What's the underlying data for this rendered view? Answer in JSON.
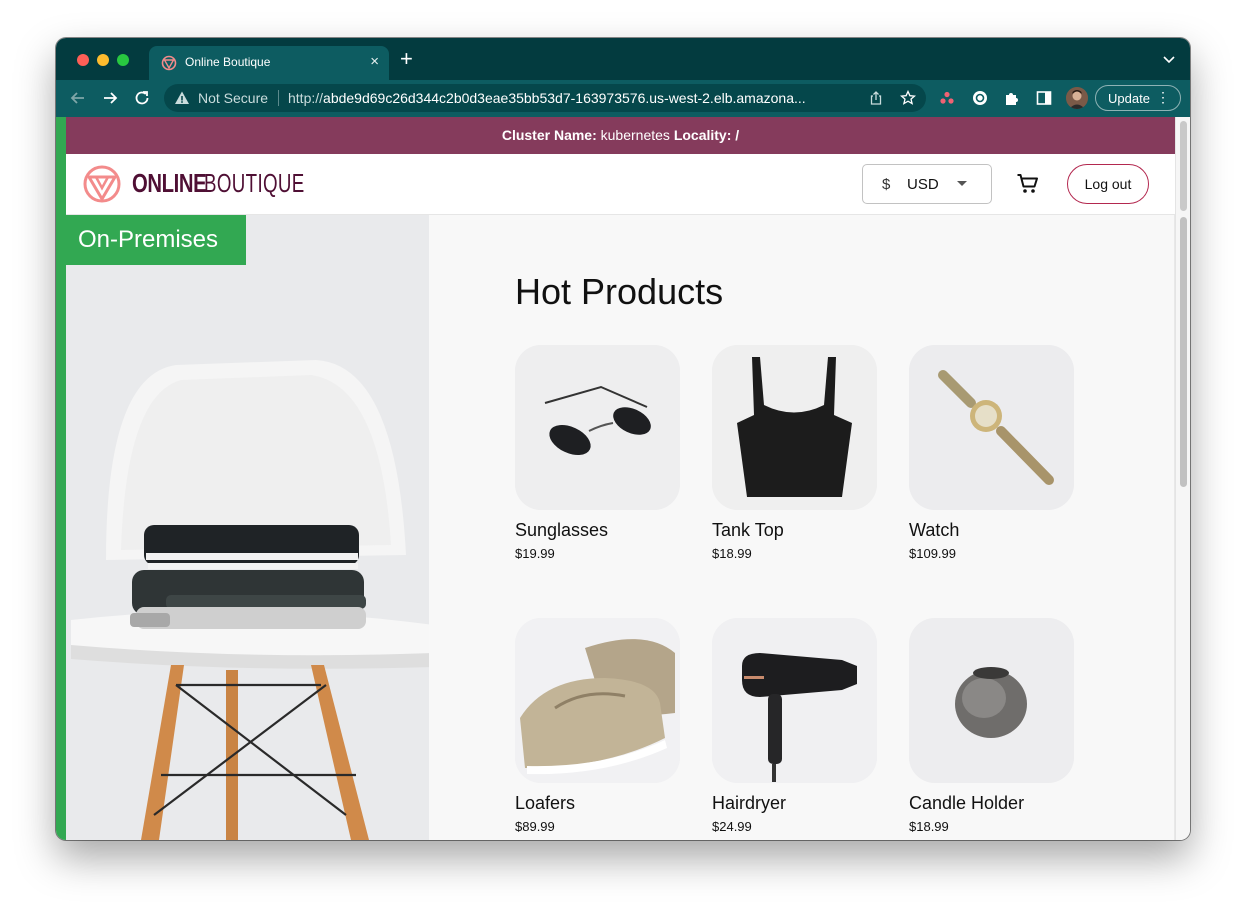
{
  "browser": {
    "tab_title": "Online Boutique",
    "tab_close": "×",
    "new_tab": "+",
    "security_label": "Not Secure",
    "url_scheme": "http://",
    "url_host": "abde9d69c26d344c2b0d3eae35bb53d7-163973576.us-west-2.elb.amazona...",
    "update_label": "Update",
    "update_dots": "⋮",
    "icons": [
      "back-arrow-icon",
      "forward-arrow-icon",
      "reload-icon",
      "warning-icon",
      "share-icon",
      "bookmark-star-icon",
      "extension-dots-icon",
      "extension-circle-icon",
      "puzzle-icon",
      "side-panel-icon",
      "profile-avatar"
    ]
  },
  "cluster_bar": {
    "name_label": "Cluster Name:",
    "name_value": "kubernetes",
    "locality_label": "Locality:",
    "locality_value": "/"
  },
  "header": {
    "logo_bold": "ONLINE",
    "logo_light": "BOUTIQUE",
    "currency_symbol": "$",
    "currency_code": "USD",
    "logout_label": "Log out"
  },
  "hero": {
    "badge": "On-Premises"
  },
  "main": {
    "title": "Hot Products",
    "products": [
      {
        "name": "Sunglasses",
        "price": "$19.99"
      },
      {
        "name": "Tank Top",
        "price": "$18.99"
      },
      {
        "name": "Watch",
        "price": "$109.99"
      },
      {
        "name": "Loafers",
        "price": "$89.99"
      },
      {
        "name": "Hairdryer",
        "price": "$24.99"
      },
      {
        "name": "Candle Holder",
        "price": "$18.99"
      }
    ]
  },
  "colors": {
    "tabstrip": "#033b3f",
    "toolbar": "#0d5c61",
    "cluster_bar": "#853b5c",
    "brand": "#4f0f34",
    "logo_accent": "#f38b8b",
    "onprem_green": "#32a852",
    "logout_border": "#b3284f"
  }
}
